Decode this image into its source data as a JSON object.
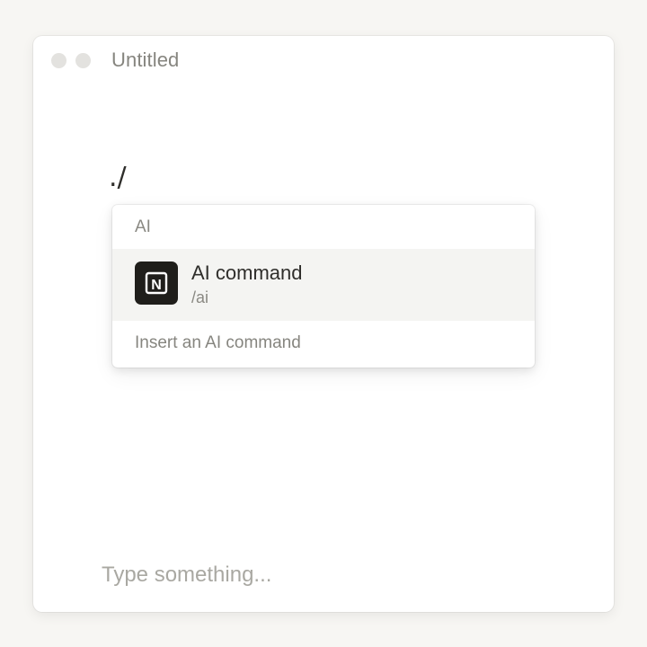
{
  "window": {
    "title": "Untitled"
  },
  "editor": {
    "current_line": "./"
  },
  "slash_menu": {
    "section_label": "AI",
    "items": [
      {
        "title": "AI command",
        "shortcut": "/ai",
        "icon": "notion-logo-icon",
        "icon_letter": "N"
      }
    ],
    "footer_hint": "Insert an AI command"
  },
  "input": {
    "value": "",
    "placeholder": "Type something..."
  },
  "colors": {
    "background": "#f7f6f3",
    "window": "#ffffff",
    "highlight": "#f4f4f2",
    "icon_bg": "#1f1e1b",
    "text": "#2f2e2b",
    "muted": "#8a8983"
  }
}
